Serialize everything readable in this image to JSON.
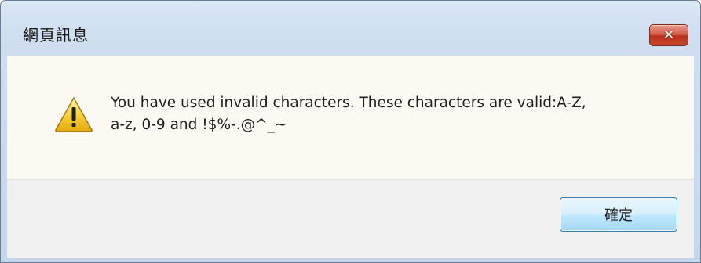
{
  "window": {
    "title": "網頁訊息",
    "close_icon": "close-icon"
  },
  "dialog": {
    "icon": "warning-icon",
    "message_line1": "You have used invalid characters. These characters are valid:A-Z,",
    "message_line2": "a-z, 0-9 and !$%-.@^_~"
  },
  "buttons": {
    "ok_label": "確定"
  },
  "colors": {
    "frame": "#cfdff0",
    "content_bg": "#fcf9f2",
    "footer_bg": "#f0f0f0",
    "close_red": "#c8462b",
    "button_blue": "#bee6fd",
    "warning_yellow": "#f6d23a"
  }
}
